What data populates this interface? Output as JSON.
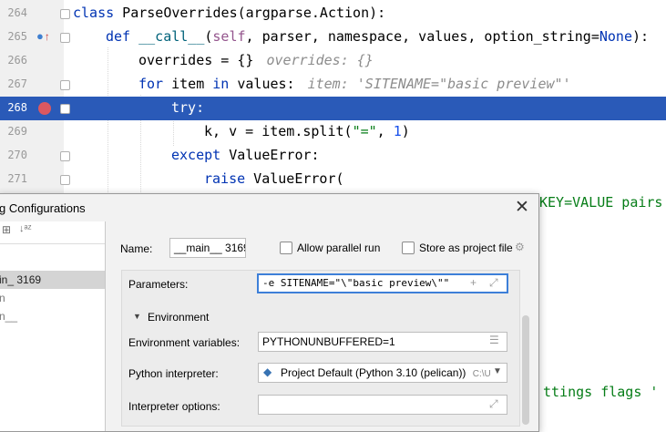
{
  "editor": {
    "lines": [
      {
        "num": "264"
      },
      {
        "num": "265"
      },
      {
        "num": "266"
      },
      {
        "num": "267"
      },
      {
        "num": "268"
      },
      {
        "num": "269"
      },
      {
        "num": "270"
      },
      {
        "num": "271"
      }
    ],
    "code": {
      "l264_kw": "class",
      "l264_rest": " ParseOverrides(argparse.Action):",
      "l265_kw": "def",
      "l265_fn": "__call__",
      "l265_p1": "(",
      "l265_self": "self",
      "l265_p2": ", parser, namespace, values, option_string=",
      "l265_none": "None",
      "l265_p3": "):",
      "l266_code": "overrides = {}",
      "l266_hint": "overrides: {}",
      "l267_for": "for",
      "l267_mid": " item ",
      "l267_in": "in",
      "l267_end": " values:",
      "l267_hint": "item: 'SITENAME=\"basic preview\"'",
      "l268_try": "try:",
      "l269_a": "k, v = item.split(",
      "l269_str": "\"=\"",
      "l269_b": ", ",
      "l269_num": "1",
      "l269_c": ")",
      "l270_kw": "except",
      "l270_rest": " ValueError:",
      "l271_kw": "raise",
      "l271_rest": " ValueError("
    },
    "right_text_1": "KEY=VALUE pairs",
    "right_text_2": "ttings flags '"
  },
  "dialog": {
    "title": "g Configurations",
    "close_glyph": "✕",
    "tree_items": [
      {
        "label": "in_ 3169"
      },
      {
        "label": "n"
      },
      {
        "label": "n__"
      }
    ],
    "name_label": "Name:",
    "name_value": "__main__ 3169",
    "allow_parallel_label": "Allow parallel run",
    "store_project_label": "Store as project file",
    "parameters_label": "Parameters:",
    "parameters_value": "-e SITENAME=\"\\\"basic preview\\\"\"",
    "environment_label": "Environment",
    "env_vars_label": "Environment variables:",
    "env_vars_value": "PYTHONUNBUFFERED=1",
    "interpreter_label": "Python interpreter:",
    "interpreter_value": "Project Default (Python 3.10 (pelican))",
    "interpreter_path": "C:\\U",
    "interp_options_label": "Interpreter options:",
    "interp_options_value": ""
  },
  "colors": {
    "highlight": "#2a5ab8",
    "keyword": "#0033b3",
    "hint": "#8c8c8c",
    "breakpoint": "#db5860",
    "focus": "#3d7fd8"
  }
}
